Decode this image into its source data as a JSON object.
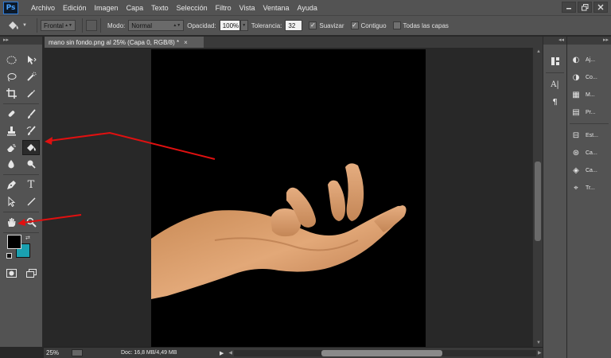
{
  "app": {
    "logo": "Ps"
  },
  "menu": [
    "Archivo",
    "Edición",
    "Imagen",
    "Capa",
    "Texto",
    "Selección",
    "Filtro",
    "Vista",
    "Ventana",
    "Ayuda"
  ],
  "window_controls": [
    "minimize-icon",
    "restore-icon",
    "close-icon"
  ],
  "options": {
    "fill_source": "Frontal",
    "mode_label": "Modo:",
    "mode_value": "Normal",
    "opacity_label": "Opacidad:",
    "opacity_value": "100%",
    "tolerance_label": "Tolerancia:",
    "tolerance_value": "32",
    "smooth_label": "Suavizar",
    "contiguous_label": "Contiguo",
    "all_layers_label": "Todas las capas",
    "checks": {
      "smooth": true,
      "contiguous": true,
      "all_layers": false
    }
  },
  "document": {
    "tab_title": "mano sin fondo.png al 25% (Capa 0, RGB/8) *",
    "close_glyph": "×"
  },
  "status": {
    "zoom": "25%",
    "doc_info": "Doc: 16,8 MB/4,49 MB",
    "arrow_glyph": "▶"
  },
  "colors": {
    "foreground": "#000000",
    "background": "#1aa0b0",
    "annotation_arrows": "#e01010",
    "ui_panel": "#535353",
    "pasteboard": "#282828"
  },
  "tools": [
    [
      "marquee-icon",
      "move-icon"
    ],
    [
      "lasso-icon",
      "quick-selection-icon"
    ],
    [
      "crop-icon",
      "eyedropper-icon"
    ],
    [
      "healing-brush-icon",
      "brush-icon"
    ],
    [
      "clone-stamp-icon",
      "history-brush-icon"
    ],
    [
      "eraser-icon",
      "paint-bucket-icon"
    ],
    [
      "blur-icon",
      "dodge-icon"
    ],
    [
      "pen-icon",
      "type-icon"
    ],
    [
      "path-selection-icon",
      "line-icon"
    ],
    [
      "hand-icon",
      "zoom-icon"
    ]
  ],
  "active_tool": "paint-bucket-icon",
  "right_dock_narrow": [
    "history-panel-icon",
    "character-panel-icon",
    "paragraph-panel-icon"
  ],
  "right_dock_panels": [
    {
      "icon": "adjustments-icon",
      "label": "Aj..."
    },
    {
      "icon": "color-icon",
      "label": "Co..."
    },
    {
      "icon": "swatches-icon",
      "label": "M..."
    },
    {
      "icon": "properties-icon",
      "label": "Pr..."
    },
    {
      "icon": "styles-icon",
      "label": "Est..."
    },
    {
      "icon": "channels-icon",
      "label": "Ca..."
    },
    {
      "icon": "layers-icon",
      "label": "Ca..."
    },
    {
      "icon": "paths-icon",
      "label": "Tr..."
    }
  ]
}
